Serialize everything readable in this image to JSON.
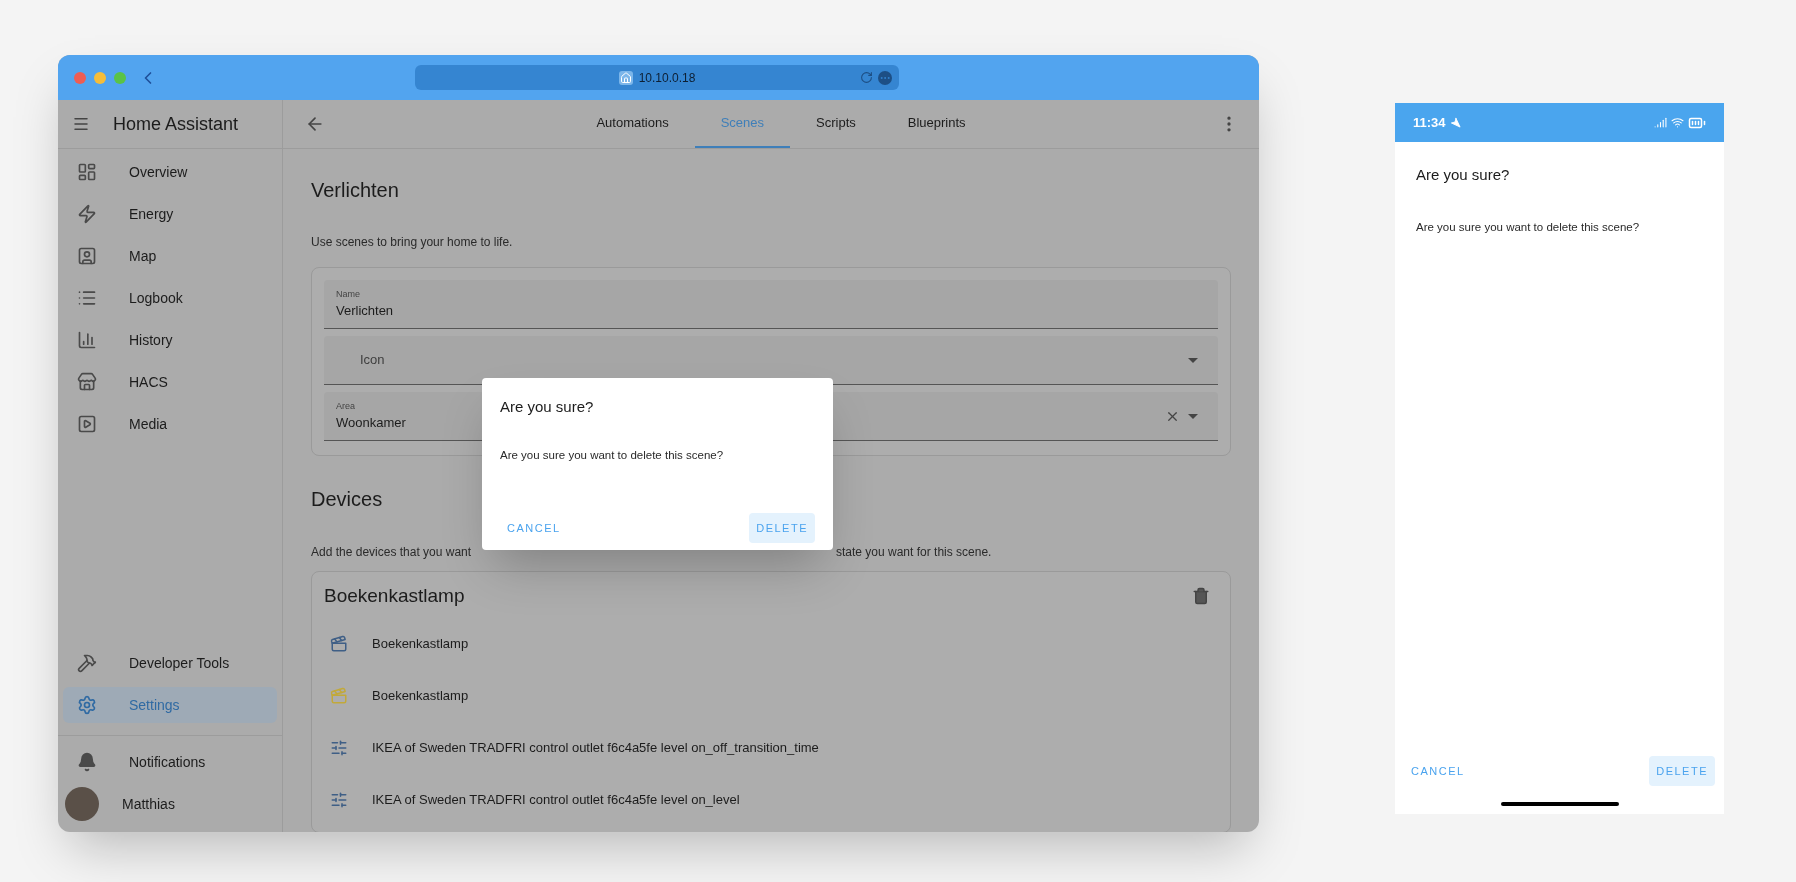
{
  "browser": {
    "url": "10.10.0.18"
  },
  "sidebar": {
    "title": "Home Assistant",
    "items": [
      {
        "label": "Overview",
        "selected": false
      },
      {
        "label": "Energy",
        "selected": false
      },
      {
        "label": "Map",
        "selected": false
      },
      {
        "label": "Logbook",
        "selected": false
      },
      {
        "label": "History",
        "selected": false
      },
      {
        "label": "HACS",
        "selected": false
      },
      {
        "label": "Media",
        "selected": false
      }
    ],
    "bottom_items": [
      {
        "label": "Developer Tools",
        "selected": false
      },
      {
        "label": "Settings",
        "selected": true
      }
    ],
    "notifications": "Notifications",
    "user": "Matthias"
  },
  "tabs": [
    {
      "label": "Automations",
      "selected": false
    },
    {
      "label": "Scenes",
      "selected": true
    },
    {
      "label": "Scripts",
      "selected": false
    },
    {
      "label": "Blueprints",
      "selected": false
    }
  ],
  "scene": {
    "title": "Verlichten",
    "description": "Use scenes to bring your home to life.",
    "fields": [
      {
        "kind": "text",
        "label": "Name",
        "value": "Verlichten"
      },
      {
        "kind": "icon",
        "placeholder": "Icon"
      },
      {
        "kind": "area",
        "label": "Area",
        "value": "Woonkamer"
      }
    ]
  },
  "devices": {
    "heading": "Devices",
    "description_parts": [
      "Add the devices that you want",
      "state you want for this scene."
    ],
    "card": {
      "title": "Boekenkastlamp",
      "entities": [
        {
          "kind": "scene",
          "name": "Boekenkastlamp",
          "color": "#3f5f86"
        },
        {
          "kind": "scene",
          "name": "Boekenkastlamp",
          "color": "#c2a93a"
        },
        {
          "kind": "number",
          "name": "IKEA of Sweden TRADFRI control outlet f6c4a5fe level on_off_transition_time",
          "color": "#3f5f86"
        },
        {
          "kind": "number",
          "name": "IKEA of Sweden TRADFRI control outlet f6c4a5fe level on_level",
          "color": "#3f5f86"
        }
      ]
    }
  },
  "dialog": {
    "title": "Are you sure?",
    "message": "Are you sure you want to delete this scene?",
    "buttons": [
      {
        "label": "CANCEL",
        "highlighted": false
      },
      {
        "label": "DELETE",
        "highlighted": true
      }
    ]
  },
  "phone": {
    "time": "11:34",
    "dialog": {
      "title": "Are you sure?",
      "message": "Are you sure you want to delete this scene?",
      "buttons": [
        {
          "label": "CANCEL",
          "highlighted": false
        },
        {
          "label": "DELETE",
          "highlighted": true
        }
      ]
    }
  }
}
